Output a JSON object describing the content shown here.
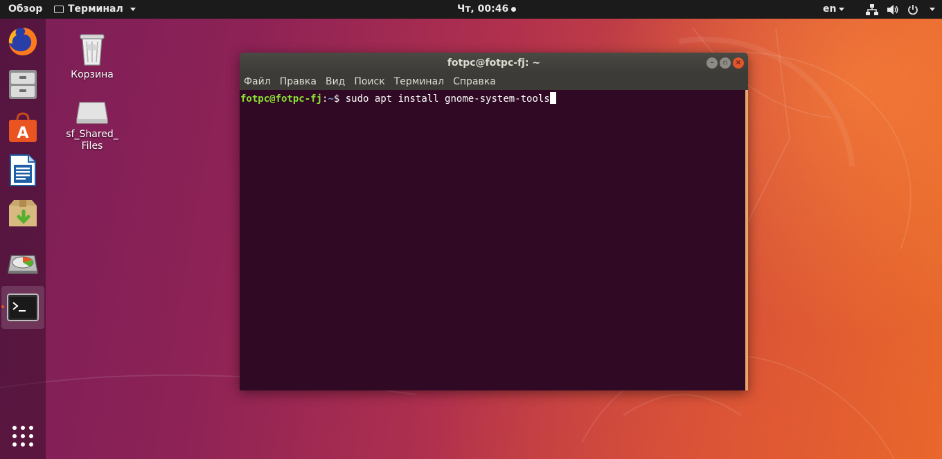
{
  "topbar": {
    "overview": "Обзор",
    "app_menu": "Терминал",
    "clock": "Чт, 00:46",
    "language": "en"
  },
  "dock": {
    "items": [
      {
        "name": "Firefox",
        "icon": "firefox-icon"
      },
      {
        "name": "Files",
        "icon": "file-cabinet-icon"
      },
      {
        "name": "Software",
        "icon": "shopping-bag-icon"
      },
      {
        "name": "Writer",
        "icon": "document-icon"
      },
      {
        "name": "Archive",
        "icon": "box-download-icon"
      },
      {
        "name": "Disk",
        "icon": "disk-icon"
      },
      {
        "name": "Terminal",
        "icon": "terminal-icon",
        "active": true
      }
    ],
    "apps_grid_icon": "grid-icon"
  },
  "desktop_icons": [
    {
      "label": "Корзина",
      "icon": "trash-icon"
    },
    {
      "label_line1": "sf_Shared_",
      "label_line2": "Files",
      "icon": "drive-icon"
    }
  ],
  "terminal": {
    "title": "fotpc@fotpc-fj: ~",
    "menu": [
      "Файл",
      "Правка",
      "Вид",
      "Поиск",
      "Терминал",
      "Справка"
    ],
    "prompt_user": "fotpc@fotpc-fj",
    "prompt_sep": ":",
    "prompt_path": "~",
    "prompt_symbol": "$ ",
    "command": "sudo apt install gnome-system-tools"
  },
  "colors": {
    "topbar_bg": "#1c1b1c",
    "terminal_bg": "#300a24",
    "prompt_green": "#8ae234",
    "prompt_blue": "#729fcf",
    "accent_orange": "#e95420"
  }
}
